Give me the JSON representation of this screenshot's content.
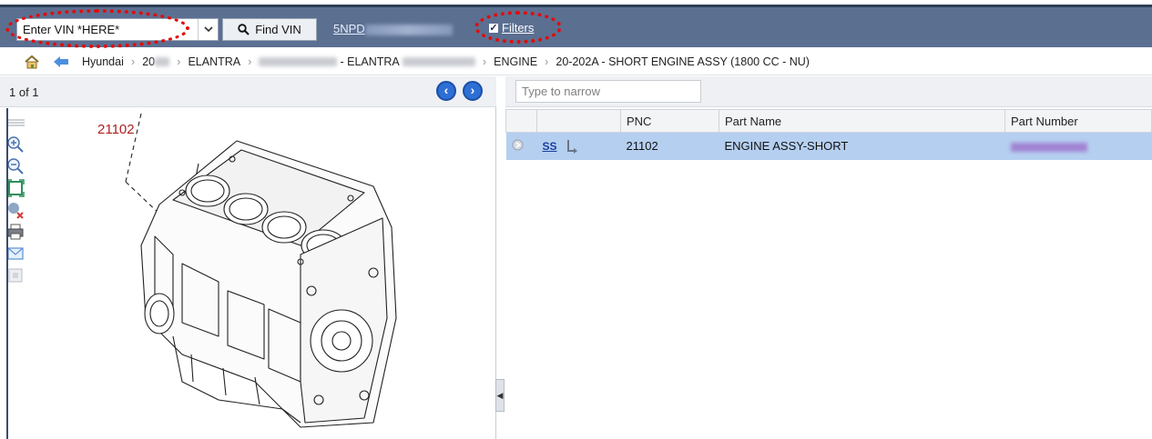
{
  "topbar": {
    "vin_input_value": "Enter VIN *HERE*",
    "find_button_label": "Find VIN",
    "vin_link_prefix": "5NPD",
    "filters_label": "Filters",
    "filters_checked": true
  },
  "breadcrumb": {
    "make": "Hyundai",
    "year_prefix": "20",
    "model": "ELANTRA",
    "variant_suffix": "- ELANTRA",
    "category": "ENGINE",
    "section": "20-202A - SHORT ENGINE ASSY (1800 CC - NU)"
  },
  "diagram": {
    "pager_text": "1 of 1",
    "callout": "21102"
  },
  "parts_list": {
    "narrow_placeholder": "Type to narrow",
    "columns": [
      "PNC",
      "Part Name",
      "Part Number"
    ],
    "rows": [
      {
        "ss_label": "SS",
        "pnc": "21102",
        "part_name": "ENGINE ASSY-SHORT"
      }
    ]
  },
  "colors": {
    "header_bar": "#5b6f91",
    "annotation_red": "#e30b0b",
    "selected_row": "#b5cff0",
    "link_blue": "#1a3f9c"
  }
}
